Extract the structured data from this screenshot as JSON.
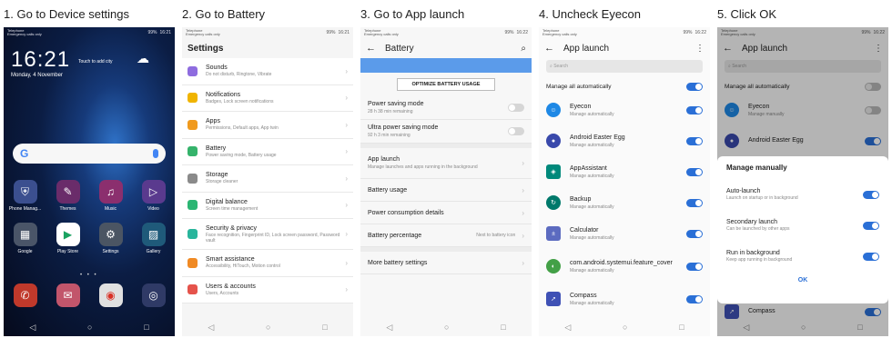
{
  "steps": [
    {
      "title": "1. Go to Device settings"
    },
    {
      "title": "2. Go to Battery"
    },
    {
      "title": "3. Go to App launch"
    },
    {
      "title": "4. Uncheck Eyecon"
    },
    {
      "title": "5. Click OK"
    }
  ],
  "status": {
    "carrier_home": "Telephone\nEmergency calls only",
    "time_home": "16:21",
    "battery_home": "99%",
    "time_settings": "16:21",
    "battery_settings": "99%",
    "time_battery": "16:22",
    "battery_battery": "99%",
    "time_launch": "16:22",
    "battery_launch": "99%"
  },
  "home": {
    "clock": "16:21",
    "touch_note": "Touch to add city",
    "date": "Monday, 4 November",
    "apps": [
      {
        "label": "Phone Manag...",
        "icon": "shield-icon",
        "color": "#3b4f8f"
      },
      {
        "label": "Themes",
        "icon": "brush-icon",
        "color": "#6a2c6a"
      },
      {
        "label": "Music",
        "icon": "music-icon",
        "color": "#8b2f6e"
      },
      {
        "label": "Video",
        "icon": "play-icon",
        "color": "#5a3a8e"
      },
      {
        "label": "Google",
        "icon": "google-folder-icon",
        "color": "#4a5568"
      },
      {
        "label": "Play Store",
        "icon": "play-store-icon",
        "color": "#ffffff"
      },
      {
        "label": "Settings",
        "icon": "gear-icon",
        "color": "#4b5563"
      },
      {
        "label": "Gallery",
        "icon": "gallery-icon",
        "color": "#1f5a7a"
      }
    ],
    "dock": [
      {
        "name": "phone-icon",
        "color": "#c0392b"
      },
      {
        "name": "messages-icon",
        "color": "#c2556b"
      },
      {
        "name": "chrome-icon",
        "color": "#e0e0e0"
      },
      {
        "name": "camera-icon",
        "color": "#2f3a66"
      }
    ]
  },
  "settings": {
    "title": "Settings",
    "items": [
      {
        "label": "Sounds",
        "sub": "Do not disturb, Ringtone, Vibrate",
        "color": "#8e6cdf"
      },
      {
        "label": "Notifications",
        "sub": "Badges, Lock screen notifications",
        "color": "#f0b400"
      },
      {
        "label": "Apps",
        "sub": "Permissions, Default apps, App twin",
        "color": "#f09a1e"
      },
      {
        "label": "Battery",
        "sub": "Power saving mode, Battery usage",
        "color": "#35b36b"
      },
      {
        "label": "Storage",
        "sub": "Storage cleaner",
        "color": "#8a8a8a"
      },
      {
        "label": "Digital balance",
        "sub": "Screen time management",
        "color": "#2bb673"
      },
      {
        "label": "Security & privacy",
        "sub": "Face recognition, Fingerprint ID, Lock screen password, Password vault",
        "color": "#29b59c"
      },
      {
        "label": "Smart assistance",
        "sub": "Accessibility, HiTouch, Motion control",
        "color": "#f08a24"
      },
      {
        "label": "Users & accounts",
        "sub": "Users, Accounts",
        "color": "#e5534b"
      }
    ]
  },
  "battery": {
    "title": "Battery",
    "optimize_label": "OPTIMIZE BATTERY USAGE",
    "power_saving": {
      "label": "Power saving mode",
      "sub": "28 h 38 min remaining"
    },
    "ultra_saving": {
      "label": "Ultra power saving mode",
      "sub": "92 h 3 min remaining"
    },
    "app_launch": {
      "label": "App launch",
      "sub": "Manage launches and apps running in the background"
    },
    "battery_usage": "Battery usage",
    "power_details": "Power consumption details",
    "battery_percentage": {
      "label": "Battery percentage",
      "value": "Next to battery icon"
    },
    "more_settings": "More battery settings"
  },
  "app_launch": {
    "title": "App launch",
    "search_placeholder": "Search",
    "manage_all": "Manage all automatically",
    "apps": [
      {
        "name": "Eyecon",
        "sub": "Manage automatically",
        "color": "#1e88e5"
      },
      {
        "name": "Android Easter Egg",
        "sub": "Manage automatically",
        "color": "#3949ab"
      },
      {
        "name": "AppAssistant",
        "sub": "Manage automatically",
        "color": "#00897b"
      },
      {
        "name": "Backup",
        "sub": "Manage automatically",
        "color": "#00796b"
      },
      {
        "name": "Calculator",
        "sub": "Manage automatically",
        "color": "#5c6bc0"
      },
      {
        "name": "com.android.systemui.feature_cover",
        "sub": "Manage automatically",
        "color": "#43a047"
      },
      {
        "name": "Compass",
        "sub": "Manage automatically",
        "color": "#3f51b5"
      }
    ]
  },
  "dialog": {
    "manage_all": "Manage all automatically",
    "eyecon": {
      "name": "Eyecon",
      "sub": "Manage manually"
    },
    "easter_egg": "Android Easter Egg",
    "compass": "Compass",
    "title": "Manage manually",
    "options": [
      {
        "label": "Auto-launch",
        "sub": "Launch on startup or in background"
      },
      {
        "label": "Secondary launch",
        "sub": "Can be launched by other apps"
      },
      {
        "label": "Run in background",
        "sub": "Keep app running in background"
      }
    ],
    "ok_label": "OK"
  },
  "colors": {
    "accent": "#2a6fd6",
    "battery_bar": "#5b9bea"
  }
}
